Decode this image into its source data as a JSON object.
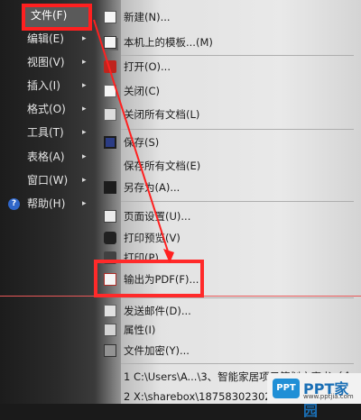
{
  "left_menu": {
    "items": [
      {
        "label": "文件(F)",
        "has_arrow": false
      },
      {
        "label": "编辑(E)",
        "has_arrow": true
      },
      {
        "label": "视图(V)",
        "has_arrow": true
      },
      {
        "label": "插入(I)",
        "has_arrow": true
      },
      {
        "label": "格式(O)",
        "has_arrow": true
      },
      {
        "label": "工具(T)",
        "has_arrow": true
      },
      {
        "label": "表格(A)",
        "has_arrow": true
      },
      {
        "label": "窗口(W)",
        "has_arrow": true
      },
      {
        "label": "帮助(H)",
        "has_arrow": true
      }
    ],
    "arrow_glyph": "▸",
    "help_icon_glyph": "?"
  },
  "file_menu": {
    "items": [
      {
        "label": "新建(N)...",
        "icon": "new-document-icon"
      },
      {
        "label": "本机上的模板...(M)",
        "icon": "template-icon"
      },
      {
        "label": "打开(O)...",
        "icon": "open-folder-icon"
      },
      {
        "label": "关闭(C)",
        "icon": "close-document-icon"
      },
      {
        "label": "关闭所有文档(L)",
        "icon": "close-all-icon"
      },
      {
        "label": "保存(S)",
        "icon": "save-icon"
      },
      {
        "label": "保存所有文档(E)",
        "icon": null
      },
      {
        "label": "另存为(A)...",
        "icon": "save-as-icon"
      },
      {
        "label": "页面设置(U)...",
        "icon": "page-setup-icon"
      },
      {
        "label": "打印预览(V)",
        "icon": "print-preview-icon"
      },
      {
        "label": "打印(P)...",
        "icon": "print-icon"
      },
      {
        "label": "输出为PDF(F)...",
        "icon": "pdf-icon"
      },
      {
        "label": "发送邮件(D)...",
        "icon": "send-mail-icon"
      },
      {
        "label": "属性(I)",
        "icon": "properties-icon"
      },
      {
        "label": "文件加密(Y)...",
        "icon": "encrypt-icon"
      },
      {
        "label": "1 C:\\Users\\A...\\3、智能家居项目策划方案书（含...",
        "icon": null
      },
      {
        "label": "2 X:\\sharebox\\18758302302...",
        "icon": null
      }
    ]
  },
  "watermark": {
    "logo": "PPT",
    "text": "PPT家园",
    "url": "www.pptjia.com"
  },
  "colors": {
    "highlight": "#ff2020",
    "dark_menu_bg": "#1c1c1c",
    "light_menu_bg": "#efefef"
  }
}
